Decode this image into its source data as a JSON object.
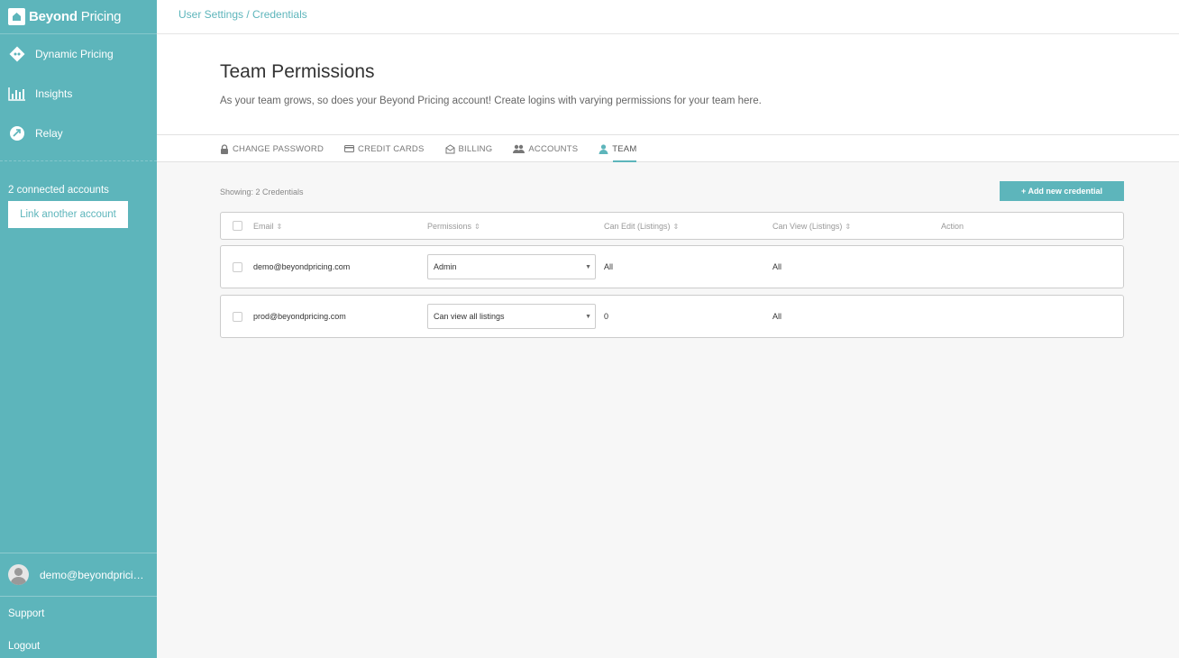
{
  "app": {
    "brand_bold": "Beyond",
    "brand_light": " Pricing"
  },
  "sidebar": {
    "nav": [
      {
        "label": "Dynamic Pricing",
        "icon": "dynamic-pricing-icon"
      },
      {
        "label": "Insights",
        "icon": "bar-chart-icon"
      },
      {
        "label": "Relay",
        "icon": "relay-icon"
      }
    ],
    "connected_accounts": "2 connected accounts",
    "link_button": "Link another account",
    "user_email": "demo@beyondpricing.com",
    "support": "Support",
    "logout": "Logout"
  },
  "breadcrumb": "User Settings / Credentials",
  "header": {
    "title": "Team Permissions",
    "description": "As your team grows, so does your Beyond Pricing account! Create logins with varying permissions for your team here."
  },
  "tabs": [
    {
      "label": "CHANGE PASSWORD",
      "icon": "lock-icon"
    },
    {
      "label": "CREDIT CARDS",
      "icon": "credit-card-icon"
    },
    {
      "label": "BILLING",
      "icon": "billing-icon"
    },
    {
      "label": "ACCOUNTS",
      "icon": "accounts-icon"
    },
    {
      "label": "TEAM",
      "icon": "user-icon",
      "active": true
    }
  ],
  "credentials": {
    "showing": "Showing: 2 Credentials",
    "add_button": "+   Add new credential",
    "columns": {
      "email": "Email",
      "permissions": "Permissions",
      "can_edit": "Can Edit (Listings)",
      "can_view": "Can View (Listings)",
      "action": "Action"
    },
    "rows": [
      {
        "email": "demo@beyondpricing.com",
        "permission": "Admin",
        "can_edit": "All",
        "can_view": "All"
      },
      {
        "email": "prod@beyondpricing.com",
        "permission": "Can view all listings",
        "can_edit": "0",
        "can_view": "All"
      }
    ]
  },
  "colors": {
    "accent": "#5db5bb",
    "background": "#f7f7f7"
  }
}
